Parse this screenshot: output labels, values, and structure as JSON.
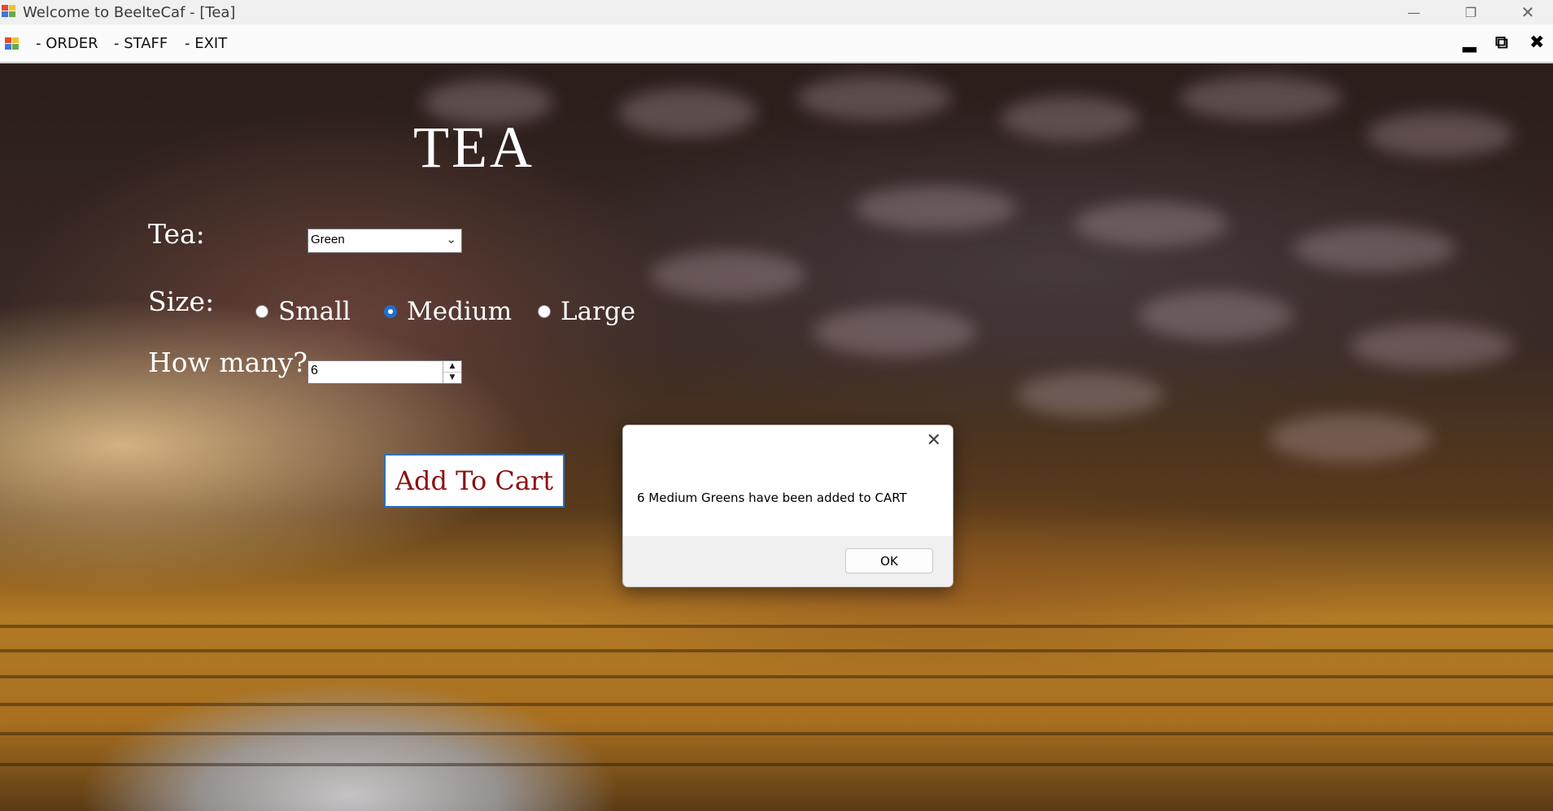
{
  "window": {
    "title": "Welcome to BeelteCaf - [Tea]",
    "minimize_icon": "minimize-icon",
    "restore_icon": "restore-icon",
    "close_icon": "close-icon"
  },
  "menu": {
    "items": [
      "- ORDER",
      "- STAFF",
      "- EXIT"
    ],
    "mdi_controls": [
      "minimize-icon",
      "restore-icon",
      "close-icon"
    ]
  },
  "form": {
    "title": "TEA",
    "tea_label": "Tea:",
    "tea_selected": "Green",
    "size_label": "Size:",
    "sizes": [
      {
        "label": "Small",
        "checked": false
      },
      {
        "label": "Medium",
        "checked": true
      },
      {
        "label": "Large",
        "checked": false
      }
    ],
    "qty_label": "How many?",
    "qty_value": "6",
    "add_button": "Add To Cart"
  },
  "dialog": {
    "message": "6 Medium Greens have been added to CART",
    "ok_label": "OK"
  },
  "colors": {
    "radio_accent": "#1f6fd0",
    "cart_text": "#8b1010",
    "cart_border": "#2f6fba"
  }
}
